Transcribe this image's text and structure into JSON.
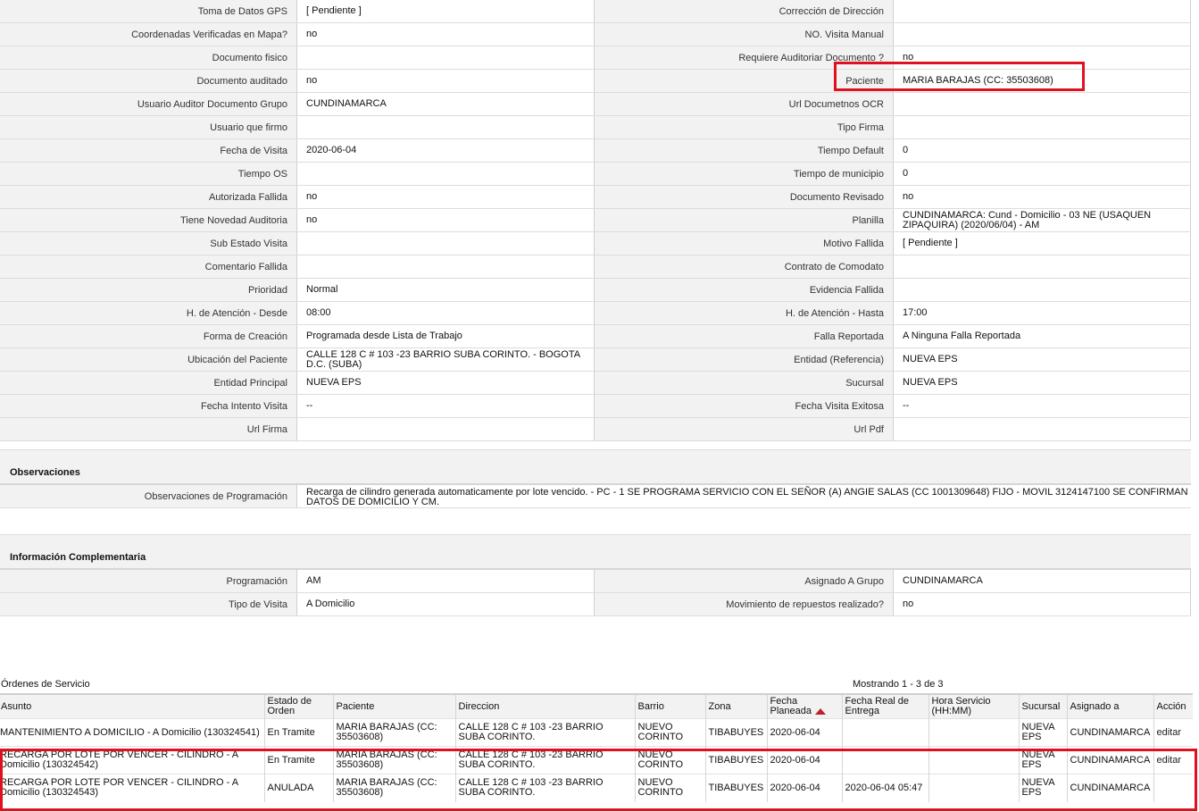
{
  "details": [
    {
      "l1": "Toma de Datos GPS",
      "v1": "[ Pendiente ]",
      "l2": "Corrección de Dirección",
      "v2": ""
    },
    {
      "l1": "Coordenadas Verificadas en Mapa?",
      "v1": "no",
      "l2": "NO. Visita Manual",
      "v2": ""
    },
    {
      "l1": "Documento fisico",
      "v1": "",
      "l2": "Requiere Auditoriar Documento ?",
      "v2": "no"
    },
    {
      "l1": "Documento auditado",
      "v1": "no",
      "l2": "Paciente",
      "v2": "MARIA BARAJAS (CC: 35503608)"
    },
    {
      "l1": "Usuario Auditor Documento Grupo",
      "v1": "CUNDINAMARCA",
      "l2": "Url Documetnos OCR",
      "v2": ""
    },
    {
      "l1": "Usuario que firmo",
      "v1": "",
      "l2": "Tipo Firma",
      "v2": ""
    },
    {
      "l1": "Fecha de Visita",
      "v1": "2020-06-04",
      "l2": "Tiempo Default",
      "v2": "0"
    },
    {
      "l1": "Tiempo OS",
      "v1": "",
      "l2": "Tiempo de municipio",
      "v2": "0"
    },
    {
      "l1": "Autorizada Fallida",
      "v1": "no",
      "l2": "Documento Revisado",
      "v2": "no"
    },
    {
      "l1": "Tiene Novedad Auditoria",
      "v1": "no",
      "l2": "Planilla",
      "v2": "CUNDINAMARCA: Cund - Domicilio - 03 NE (USAQUEN ZIPAQUIRA) (2020/06/04) - AM"
    },
    {
      "l1": "Sub Estado Visita",
      "v1": "",
      "l2": "Motivo Fallida",
      "v2": "[ Pendiente ]"
    },
    {
      "l1": "Comentario Fallida",
      "v1": "",
      "l2": "Contrato de Comodato",
      "v2": ""
    },
    {
      "l1": "Prioridad",
      "v1": "Normal",
      "l2": "Evidencia Fallida",
      "v2": ""
    },
    {
      "l1": "H. de Atención - Desde",
      "v1": "08:00",
      "l2": "H. de Atención - Hasta",
      "v2": "17:00"
    },
    {
      "l1": "Forma de Creación",
      "v1": "Programada desde Lista de Trabajo",
      "l2": "Falla Reportada",
      "v2": "A Ninguna Falla Reportada"
    },
    {
      "l1": "Ubicación del Paciente",
      "v1": "CALLE 128 C # 103 -23 BARRIO SUBA CORINTO. - BOGOTA D.C. (SUBA)",
      "l2": "Entidad (Referencia)",
      "v2": "NUEVA EPS"
    },
    {
      "l1": "Entidad Principal",
      "v1": "NUEVA EPS",
      "l2": "Sucursal",
      "v2": "NUEVA EPS"
    },
    {
      "l1": "Fecha Intento Visita",
      "v1": "--",
      "l2": "Fecha Visita Exitosa",
      "v2": "--"
    },
    {
      "l1": "Url Firma",
      "v1": "",
      "l2": "Url Pdf",
      "v2": ""
    }
  ],
  "observaciones": {
    "title": "Observaciones",
    "label": "Observaciones de Programación",
    "value": " Recarga de cilindro generada automaticamente por lote vencido. - PC - 1 SE PROGRAMA SERVICIO CON EL SEÑOR (A) ANGIE SALAS (CC 1001309648) FIJO - MOVIL 3124147100 SE CONFIRMAN DATOS DE DOMICILIO Y CM."
  },
  "complementaria": {
    "title": "Información Complementaria",
    "rows": [
      {
        "l1": "Programación",
        "v1": "AM",
        "l2": "Asignado A Grupo",
        "v2": "CUNDINAMARCA"
      },
      {
        "l1": "Tipo de Visita",
        "v1": "A Domicilio",
        "l2": "Movimiento de repuestos realizado?",
        "v2": "no"
      }
    ]
  },
  "orders": {
    "title": "Órdenes de Servicio",
    "count": "Mostrando 1 - 3 de 3",
    "headers": [
      "Asunto",
      "Estado de Orden",
      "Paciente",
      "Direccion",
      "Barrio",
      "Zona",
      "Fecha Planeada",
      "Fecha Real de Entrega",
      "Hora Servicio (HH:MM)",
      "Sucursal",
      "Asignado a",
      "Acción"
    ],
    "rows": [
      [
        "MANTENIMIENTO A DOMICILIO - A Domicilio (130324541)",
        "En Tramite",
        "MARIA BARAJAS (CC: 35503608)",
        "CALLE 128 C # 103 -23 BARRIO SUBA CORINTO.",
        "NUEVO CORINTO",
        "TIBABUYES",
        "2020-06-04",
        "",
        "",
        "NUEVA EPS",
        "CUNDINAMARCA",
        "editar"
      ],
      [
        "RECARGA POR LOTE POR VENCER - CILINDRO - A Domicilio (130324542)",
        "En Tramite",
        "MARIA BARAJAS (CC: 35503608)",
        "CALLE 128 C # 103 -23 BARRIO SUBA CORINTO.",
        "NUEVO CORINTO",
        "TIBABUYES",
        "2020-06-04",
        "",
        "",
        "NUEVA EPS",
        "CUNDINAMARCA",
        "editar"
      ],
      [
        "RECARGA POR LOTE POR VENCER - CILINDRO - A Domicilio (130324543)",
        "ANULADA",
        "MARIA BARAJAS (CC: 35503608)",
        "CALLE 128 C # 103 -23 BARRIO SUBA CORINTO.",
        "NUEVO CORINTO",
        "TIBABUYES",
        "2020-06-04",
        "2020-06-04 05:47",
        "",
        "NUEVA EPS",
        "CUNDINAMARCA",
        ""
      ]
    ]
  },
  "colors": {
    "highlight": "#e0101e",
    "label_bg": "#f2f2f2",
    "sort_arrow": "#c0202a"
  }
}
